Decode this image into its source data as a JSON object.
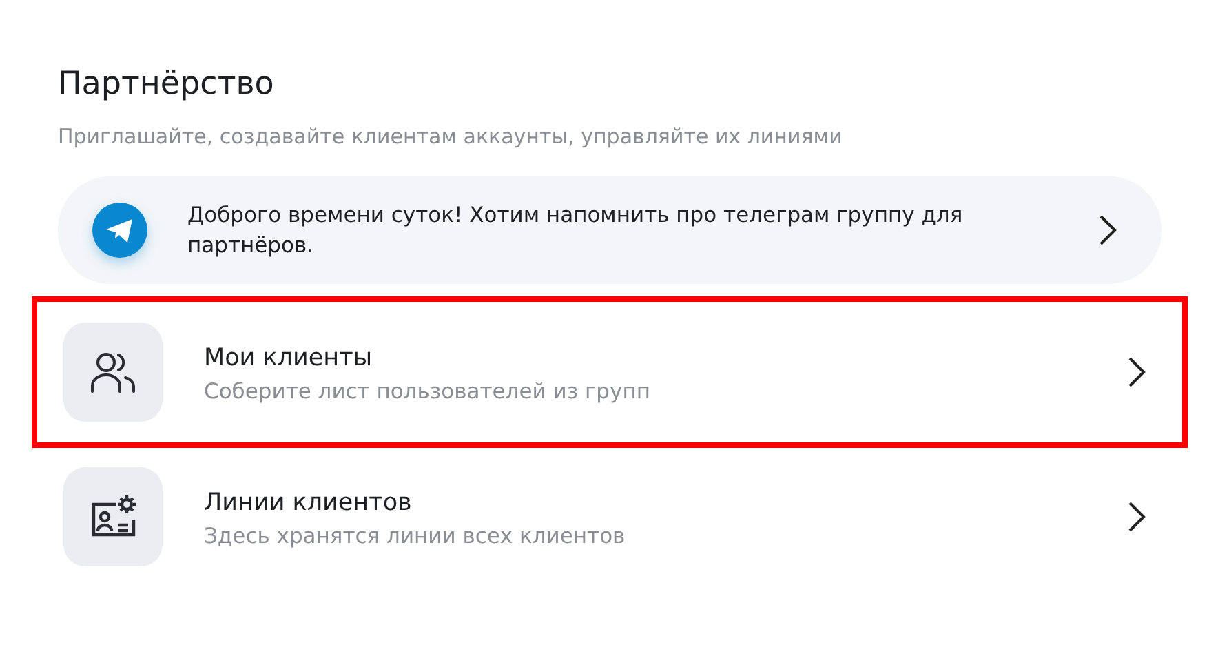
{
  "section": {
    "title": "Партнёрство",
    "subtitle": "Приглашайте, создавайте клиентам аккаунты, управляйте их линиями"
  },
  "banner": {
    "text": "Доброго времени суток! Хотим напомнить про телеграм группу для партнёров."
  },
  "items": [
    {
      "kind": "clients",
      "title": "Мои клиенты",
      "subtitle": "Соберите лист пользователей из групп",
      "highlighted": true
    },
    {
      "kind": "lines",
      "title": "Линии клиентов",
      "subtitle": "Здесь хранятся линии всех клиентов",
      "highlighted": false
    }
  ]
}
